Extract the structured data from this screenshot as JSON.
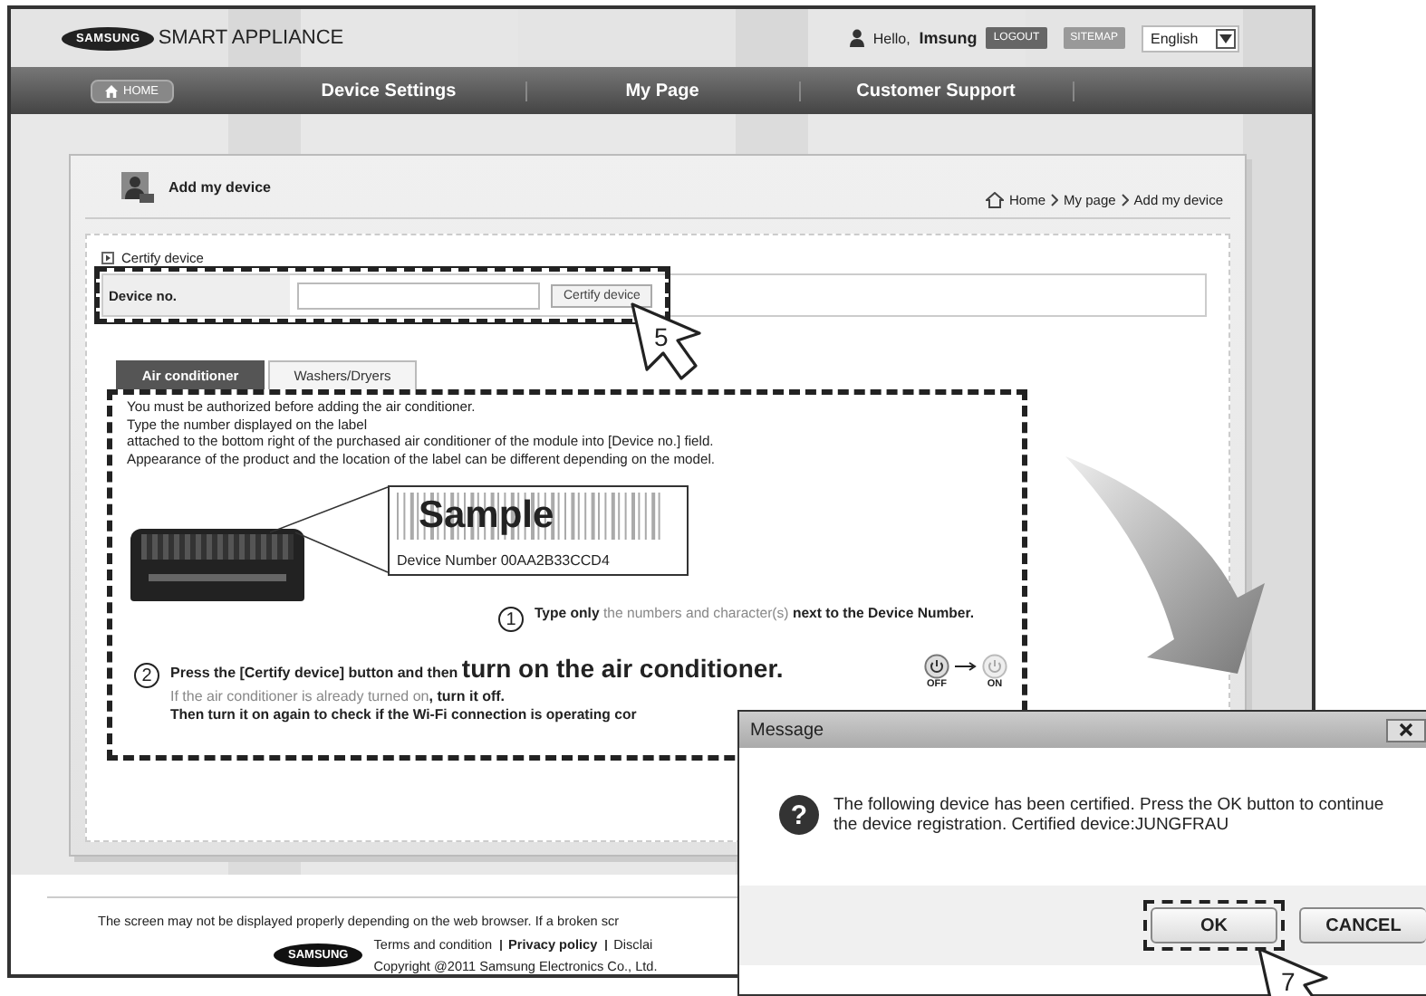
{
  "header": {
    "logo": {
      "badge": "SAMSUNG",
      "text": "SMART APPLIANCE"
    },
    "greeting": "Hello,",
    "user": "Imsung",
    "buttons": [
      "LOGOUT",
      "SITEMAP"
    ],
    "language": "English"
  },
  "nav": {
    "home": "HOME",
    "items": [
      "Device Settings",
      "My Page",
      "Customer Support"
    ]
  },
  "panel": {
    "title": "Add my device",
    "breadcrumb": [
      "Home",
      "My page",
      "Add my device"
    ]
  },
  "certify": {
    "link": "Certify device",
    "label": "Device no.",
    "button": "Certify device"
  },
  "tabs": [
    {
      "label": "Air conditioner",
      "selected": true
    },
    {
      "label": "Washers/Dryers",
      "selected": false
    }
  ],
  "instructions": [
    "You must be authorized before adding the air conditioner.",
    "Type the number displayed on the label",
    "attached to the bottom right of the purchased air conditioner of the module into [Device no.] field.",
    "Appearance of the product and the location of the label can be different depending on the model."
  ],
  "sample_label": {
    "title": "Sample",
    "device_number": "Device Number 00AA2B33CCD4"
  },
  "steps": [
    {
      "number": "1",
      "lines": [
        [
          {
            "kind": "bold",
            "text": "Type only"
          },
          {
            "kind": "muted",
            "text": " the numbers and character(s) "
          },
          {
            "kind": "bold",
            "text": "next to the Device Number."
          }
        ]
      ]
    },
    {
      "number": "2",
      "lines": [
        [
          {
            "kind": "bold",
            "text": "Press the [Certify device] button and then "
          },
          {
            "kind": "large",
            "text": "turn on the air conditioner."
          }
        ],
        [
          {
            "kind": "muted",
            "text": "If the air conditioner is already turned on"
          },
          {
            "kind": "bold",
            "text": ", turn it off."
          }
        ],
        [
          {
            "kind": "bold",
            "text": "Then turn it on again to check if the Wi-Fi connection is operating cor"
          }
        ]
      ]
    }
  ],
  "power_states": [
    "OFF",
    "ON"
  ],
  "footer": {
    "notice": "The screen may not be displayed properly depending on the web browser. If a broken scr",
    "logo": "SAMSUNG",
    "links": [
      "Terms and condition",
      "Privacy policy",
      "Disclai"
    ],
    "copyright": "Copyright @2011 Samsung Electronics Co., Ltd."
  },
  "dialog": {
    "title": "Message",
    "icon_glyph": "?",
    "message": "The following device has been certified. Press the OK button to continue the device registration. Certified device:JUNGFRAU",
    "buttons": [
      "OK",
      "CANCEL"
    ]
  },
  "callouts": [
    "5",
    "7"
  ]
}
